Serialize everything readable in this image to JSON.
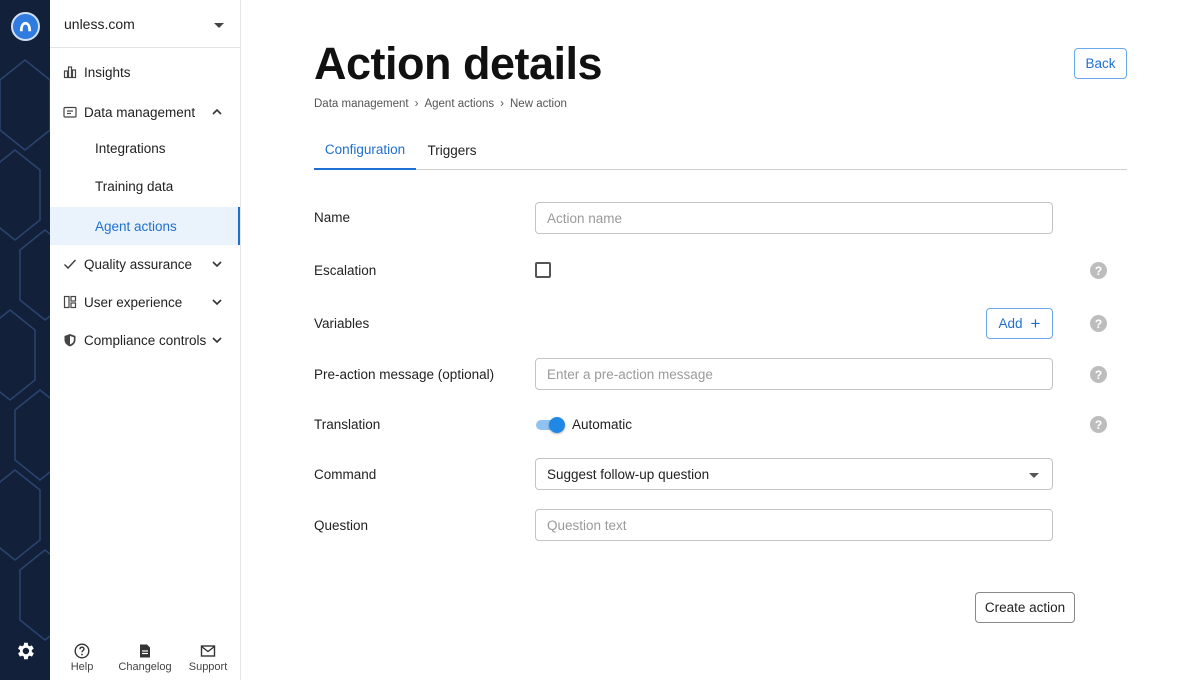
{
  "sidebar": {
    "org_name": "unless.com",
    "nav": {
      "insights": "Insights",
      "data_management": "Data management",
      "integrations": "Integrations",
      "training_data": "Training data",
      "agent_actions": "Agent actions",
      "quality_assurance": "Quality assurance",
      "user_experience": "User experience",
      "compliance_controls": "Compliance controls"
    },
    "bottom": {
      "help": "Help",
      "changelog": "Changelog",
      "support": "Support"
    }
  },
  "header": {
    "title": "Action details",
    "back_label": "Back",
    "breadcrumb": [
      "Data management",
      "Agent actions",
      "New action"
    ],
    "breadcrumb_sep": "›"
  },
  "tabs": {
    "configuration": "Configuration",
    "triggers": "Triggers",
    "active": "Configuration"
  },
  "form": {
    "name": {
      "label": "Name",
      "placeholder": "Action name",
      "value": ""
    },
    "escalation": {
      "label": "Escalation",
      "checked": false
    },
    "variables": {
      "label": "Variables",
      "add_label": "Add",
      "add_icon": "+"
    },
    "pre_action": {
      "label": "Pre-action message (optional)",
      "placeholder": "Enter a pre-action message",
      "value": ""
    },
    "translation": {
      "label": "Translation",
      "toggle_label": "Automatic",
      "on": true
    },
    "command": {
      "label": "Command",
      "selected": "Suggest follow-up question"
    },
    "question": {
      "label": "Question",
      "placeholder": "Question text",
      "value": ""
    },
    "help_glyph": "?",
    "submit_label": "Create action"
  },
  "colors": {
    "accent": "#1f6fd1",
    "rail": "#13203a",
    "active_bg": "#eaf3fc",
    "help_icon": "#bdbdbd"
  }
}
